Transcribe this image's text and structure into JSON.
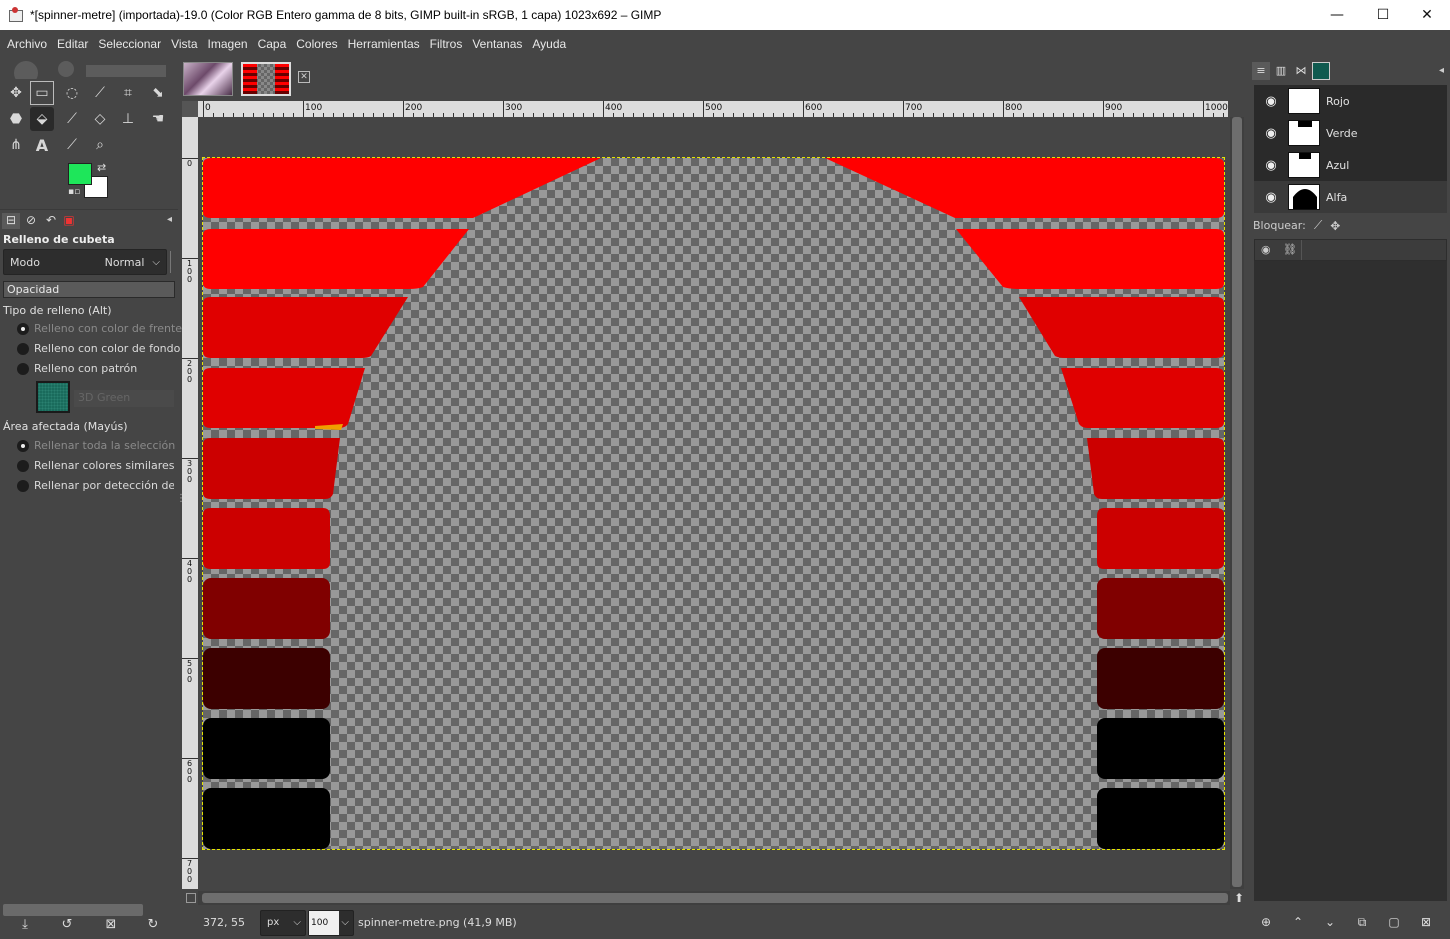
{
  "window": {
    "title": "*[spinner-metre] (importada)-19.0 (Color RGB Entero gamma de 8 bits, GIMP built-in sRGB, 1 capa) 1023x692 – GIMP",
    "controls": [
      "—",
      "☐",
      "✕"
    ]
  },
  "menu": [
    "Archivo",
    "Editar",
    "Seleccionar",
    "Vista",
    "Imagen",
    "Capa",
    "Colores",
    "Herramientas",
    "Filtros",
    "Ventanas",
    "Ayuda"
  ],
  "colors": {
    "foreground": "#1ee65a",
    "background": "#ffffff",
    "accent_pattern": "#1a6b5c"
  },
  "tools": [
    "move-tool",
    "rect-select-tool",
    "free-select-tool",
    "fuzzy-select-tool",
    "crop-tool",
    "unified-transform-tool",
    "warp-tool",
    "bucket-fill-tool",
    "paintbrush-tool",
    "eraser-tool",
    "clone-tool",
    "smudge-tool",
    "paths-tool",
    "text-tool",
    "color-picker-tool",
    "zoom-tool"
  ],
  "tool_options": {
    "title": "Relleno de cubeta",
    "mode_label": "Modo",
    "mode_value": "Normal",
    "opacity_label": "Opacidad",
    "fill_type_label": "Tipo de relleno  (Alt)",
    "fill_types": [
      "Relleno con color de frente",
      "Relleno con color de fondo",
      "Relleno con patrón"
    ],
    "fill_type_selected": 0,
    "pattern_name": "3D Green",
    "area_label": "Área afectada  (Mayús)",
    "areas": [
      "Rellenar toda la selección",
      "Rellenar colores similares",
      "Rellenar por detección de art"
    ],
    "area_selected": 0
  },
  "rulers": {
    "h_labels": [
      "0",
      "100",
      "200",
      "300",
      "400",
      "500",
      "600",
      "700",
      "800",
      "900",
      "1000"
    ],
    "v_labels": [
      "0",
      "1\n0\n0",
      "2\n0\n0",
      "3\n0\n0",
      "4\n0\n0",
      "5\n0\n0",
      "6\n0\n0",
      "7\n0\n0"
    ]
  },
  "status": {
    "coords": "372, 55",
    "unit": "px",
    "zoom": "100 %",
    "message": "spinner-metre.png (41,9 MB)"
  },
  "layers": {
    "items": [
      {
        "name": "Rojo",
        "thumb": "white"
      },
      {
        "name": "Verde",
        "thumb": "white-notch"
      },
      {
        "name": "Azul",
        "thumb": "white-notch"
      },
      {
        "name": "Alfa",
        "thumb": "black-arch"
      }
    ],
    "lock_label": "Bloquear:"
  }
}
